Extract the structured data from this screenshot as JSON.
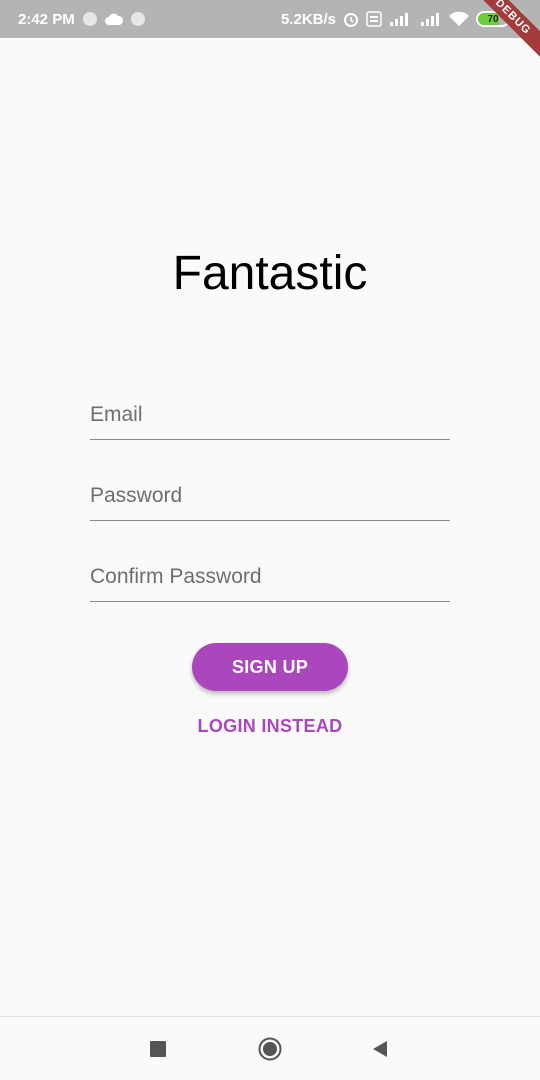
{
  "status_bar": {
    "time": "2:42 PM",
    "network_speed": "5.2KB/s",
    "battery_level": "70",
    "icons": [
      "notification-dot-icon",
      "cloud-icon",
      "notification-dot-icon",
      "alarm-icon",
      "volte-icon",
      "signal-4g-icon",
      "signal-icon",
      "wifi-icon",
      "battery-icon",
      "charging-icon"
    ]
  },
  "debug_banner": "DEBUG",
  "app": {
    "title": "Fantastic"
  },
  "form": {
    "email_placeholder": "Email",
    "password_placeholder": "Password",
    "confirm_password_placeholder": "Confirm Password",
    "signup_label": "SIGN UP",
    "login_label": "LOGIN INSTEAD"
  },
  "colors": {
    "accent": "#ab47bc",
    "status_bar": "#b4b4b4",
    "background": "#fafafa"
  },
  "nav_bar": {
    "icons": [
      "recent-apps-icon",
      "home-icon",
      "back-icon"
    ]
  }
}
